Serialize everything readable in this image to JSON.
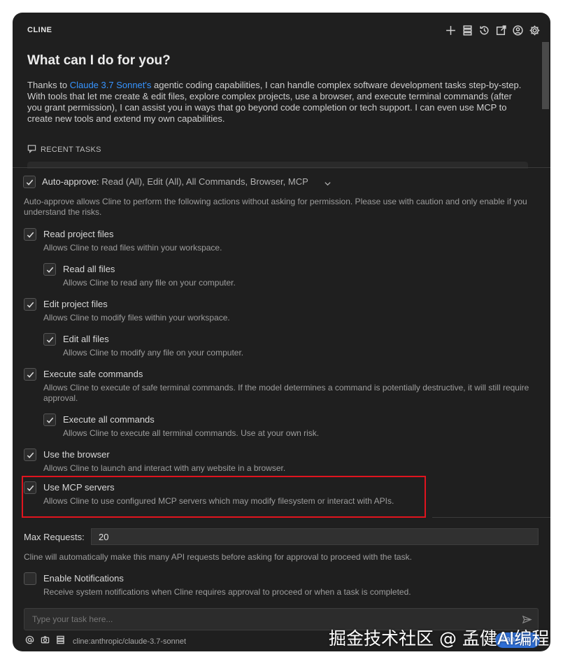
{
  "app": {
    "title": "CLINE"
  },
  "header_icons": [
    "plus-icon",
    "mcp-servers-icon",
    "history-icon",
    "popout-icon",
    "account-icon",
    "gear-icon"
  ],
  "welcome": {
    "heading": "What can I do for you?",
    "para_prefix": "Thanks to ",
    "para_link": "Claude 3.7 Sonnet's",
    "para_rest": " agentic coding capabilities, I can handle complex software development tasks step-by-step. With tools that let me create & edit files, explore complex projects, use a browser, and execute terminal commands (after you grant permission), I can assist you in ways that go beyond code completion or tech support. I can even use MCP to create new tools and extend my own capabilities."
  },
  "recent_tasks": {
    "label": "RECENT TASKS"
  },
  "auto_approve": {
    "label": "Auto-approve:",
    "summary": "Read (All), Edit (All), All Commands, Browser, MCP",
    "checked": true,
    "description": "Auto-approve allows Cline to perform the following actions without asking for permission. Please use with caution and only enable if you understand the risks.",
    "items": [
      {
        "title": "Read project files",
        "desc": "Allows Cline to read files within your workspace.",
        "checked": true
      },
      {
        "title": "Read all files",
        "desc": "Allows Cline to read any file on your computer.",
        "checked": true
      },
      {
        "title": "Edit project files",
        "desc": "Allows Cline to modify files within your workspace.",
        "checked": true
      },
      {
        "title": "Edit all files",
        "desc": "Allows Cline to modify any file on your computer.",
        "checked": true
      },
      {
        "title": "Execute safe commands",
        "desc": "Allows Cline to execute of safe terminal commands. If the model determines a command is potentially destructive, it will still require approval.",
        "checked": true
      },
      {
        "title": "Execute all commands",
        "desc": "Allows Cline to execute all terminal commands. Use at your own risk.",
        "checked": true
      },
      {
        "title": "Use the browser",
        "desc": "Allows Cline to launch and interact with any website in a browser.",
        "checked": true
      },
      {
        "title": "Use MCP servers",
        "desc": "Allows Cline to use configured MCP servers which may modify filesystem or interact with APIs.",
        "checked": true
      }
    ]
  },
  "max_requests": {
    "label": "Max Requests:",
    "value": "20",
    "desc": "Cline will automatically make this many API requests before asking for approval to proceed with the task."
  },
  "notifications": {
    "title": "Enable Notifications",
    "desc": "Receive system notifications when Cline requires approval to proceed or when a task is completed.",
    "checked": false
  },
  "task_input": {
    "placeholder": "Type your task here..."
  },
  "footer": {
    "model": "cline:anthropic/claude-3.7-sonnet",
    "mode_label": "Plan"
  },
  "watermark": "掘金技术社区 @ 孟健AI编程",
  "colors": {
    "accent_link": "#3794ff",
    "highlight": "#e0141e",
    "panel_bg": "#1f1f1f",
    "toggle": "#2f6fd6"
  }
}
